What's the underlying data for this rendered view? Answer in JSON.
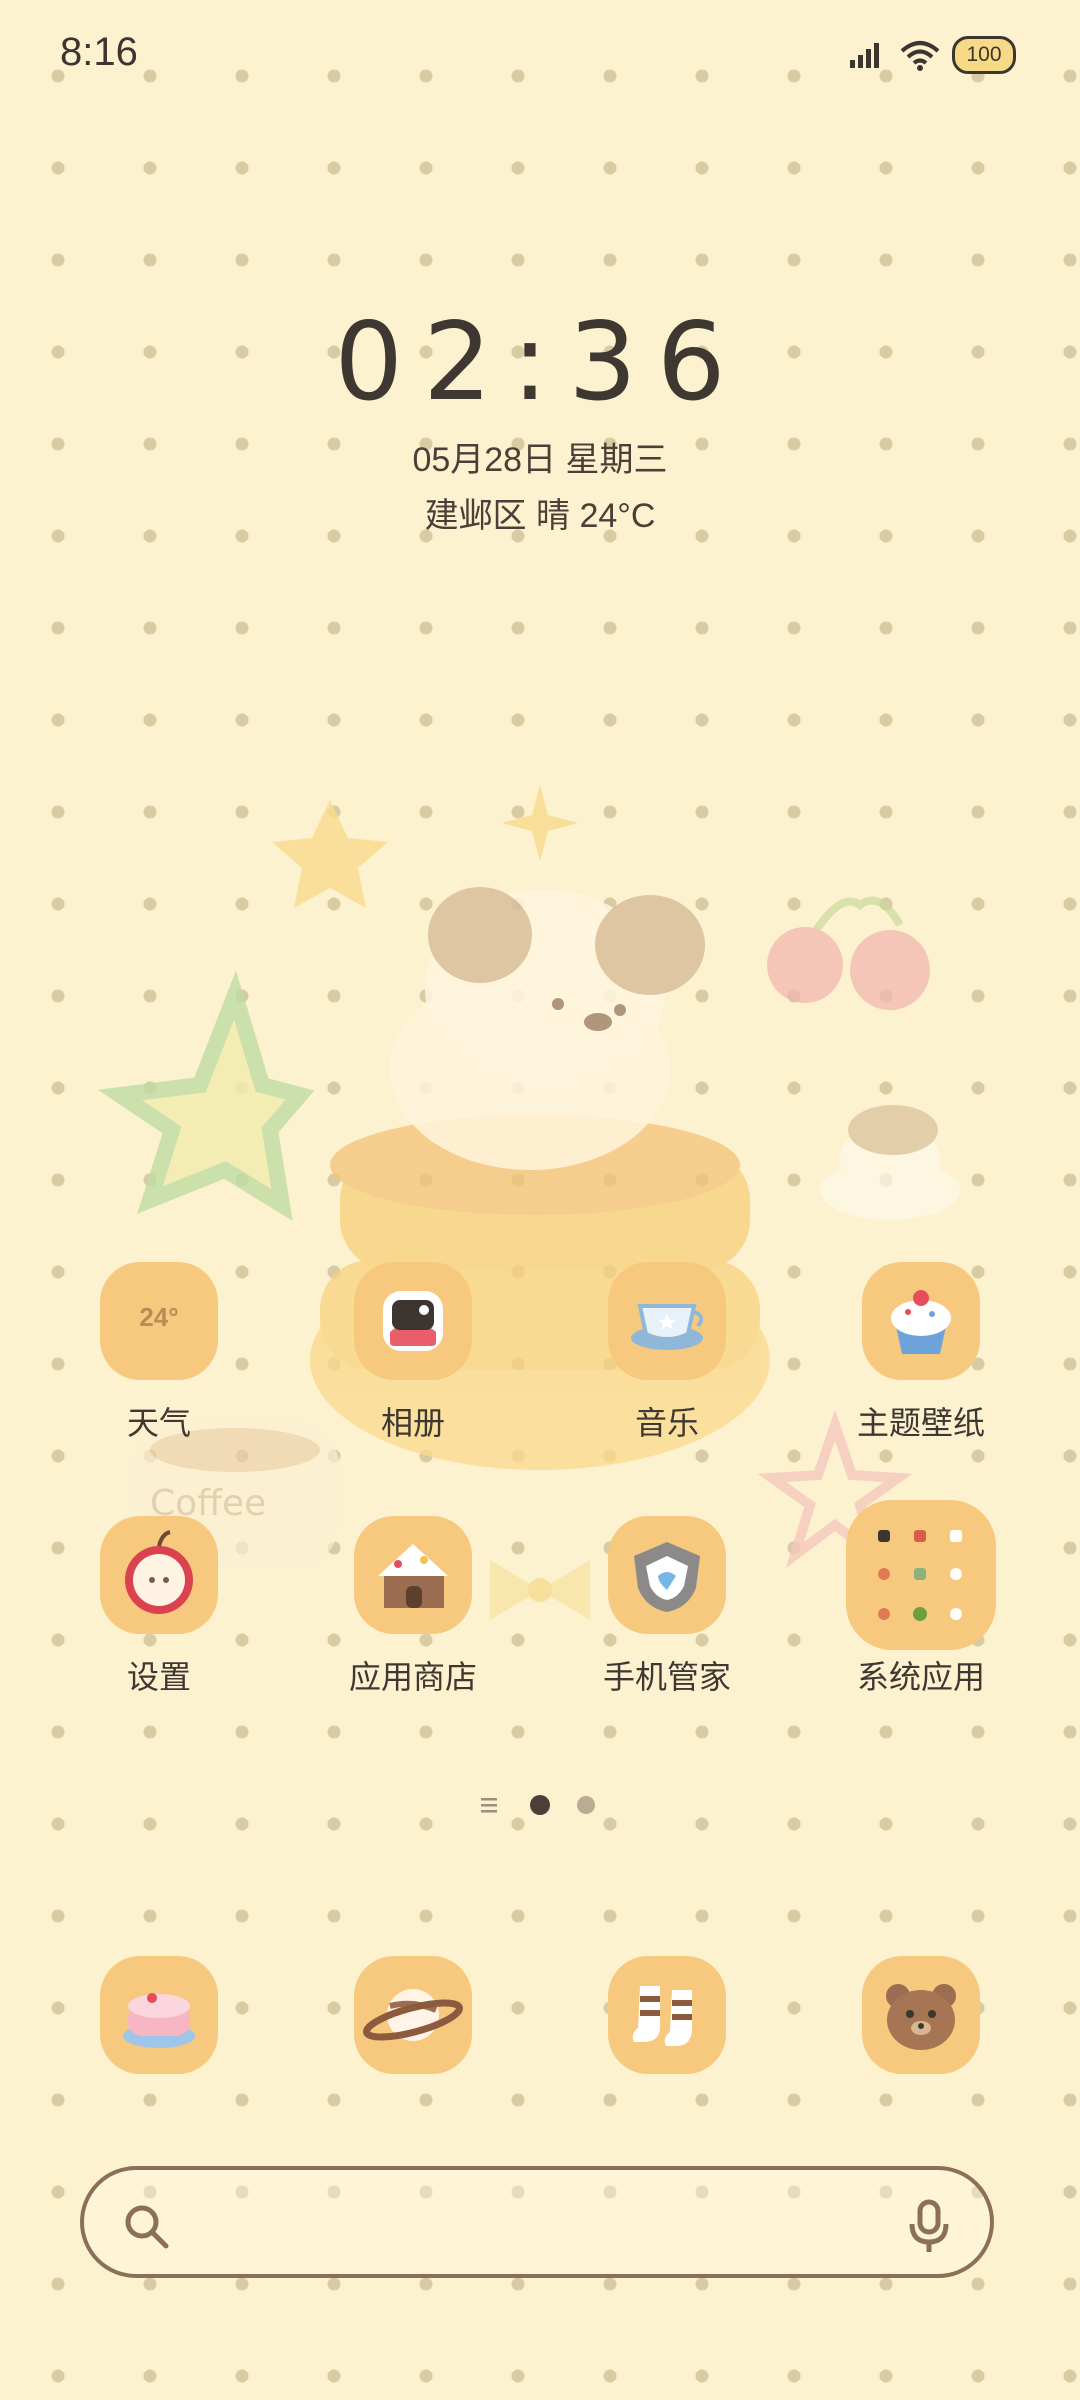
{
  "status_bar": {
    "time": "8:16",
    "battery": "100"
  },
  "clock_widget": {
    "time": "02:36",
    "date": "05月28日 星期三",
    "weather": "建邺区 晴 24°C"
  },
  "apps": [
    {
      "label": "天气",
      "icon": "weather-icon",
      "badge": "24°"
    },
    {
      "label": "相册",
      "icon": "gallery-icon"
    },
    {
      "label": "音乐",
      "icon": "music-icon"
    },
    {
      "label": "主题壁纸",
      "icon": "cupcake-icon"
    },
    {
      "label": "设置",
      "icon": "apple-icon"
    },
    {
      "label": "应用商店",
      "icon": "house-icon"
    },
    {
      "label": "手机管家",
      "icon": "shield-icon"
    },
    {
      "label": "系统应用",
      "icon": "folder-icon"
    }
  ],
  "dock": [
    {
      "icon": "cake-icon"
    },
    {
      "icon": "planet-icon"
    },
    {
      "icon": "socks-icon"
    },
    {
      "icon": "bear-icon"
    }
  ],
  "page_indicator": {
    "pages": 2,
    "current": 1
  },
  "colors": {
    "background": "#fdf2cf",
    "icon_tile": "#f6c97e",
    "text": "#3f3832",
    "search_border": "#8b7057"
  }
}
